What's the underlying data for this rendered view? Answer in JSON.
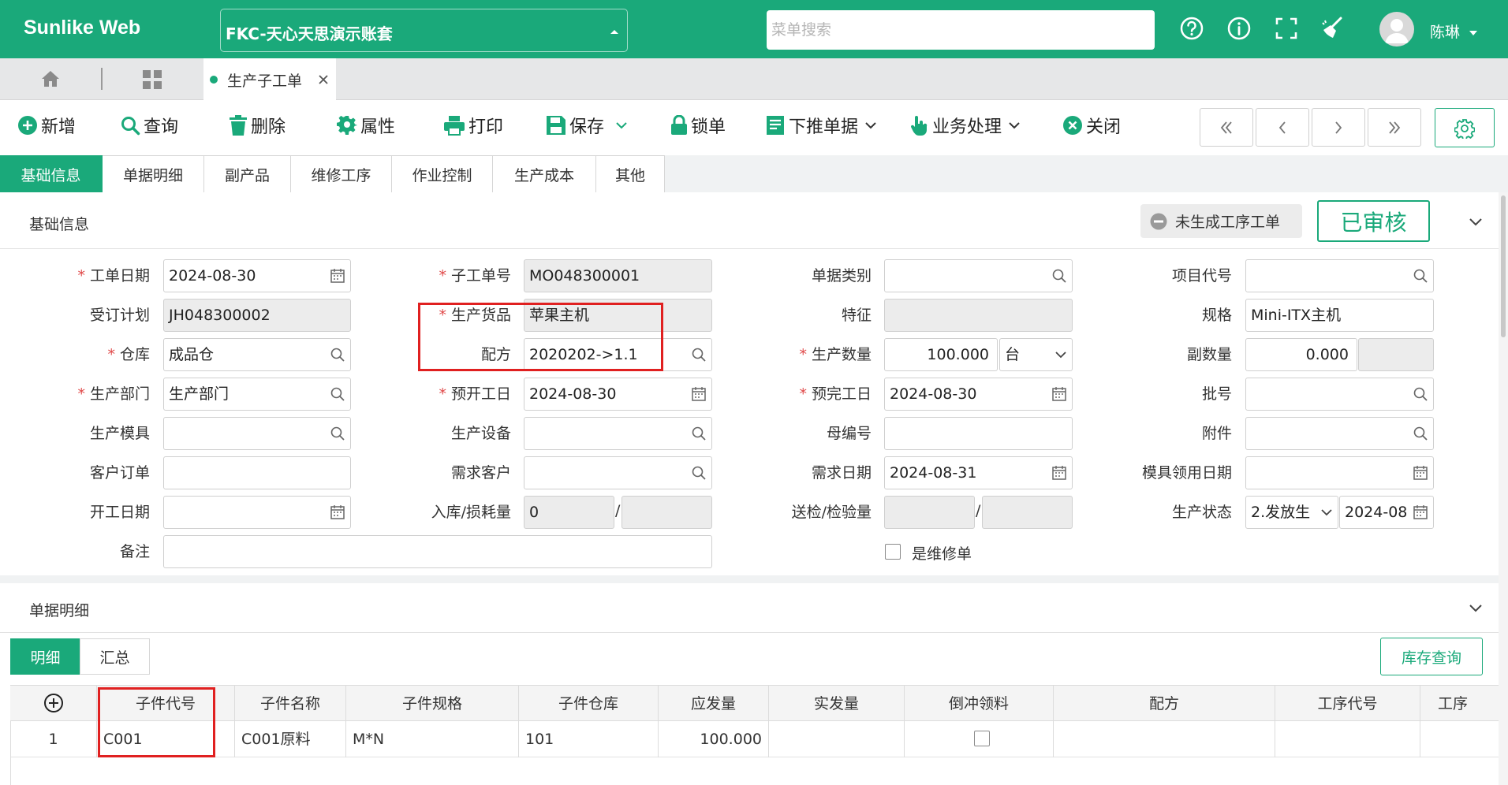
{
  "header": {
    "brand": "Sunlike Web",
    "account": "FKC-天心天思演示账套",
    "search_placeholder": "菜单搜索",
    "user": "陈琳",
    "icons": [
      "help-icon",
      "info-icon",
      "fullscreen-icon",
      "broom-icon"
    ]
  },
  "tabs": {
    "home_icon": "home-icon",
    "apps_icon": "grid-icon",
    "active_tab": "生产子工单"
  },
  "toolbar": {
    "add": "新增",
    "query": "查询",
    "delete": "删除",
    "properties": "属性",
    "print": "打印",
    "save": "保存",
    "lock": "锁单",
    "push_down": "下推单据",
    "business": "业务处理",
    "close": "关闭"
  },
  "section_tabs": [
    "基础信息",
    "单据明细",
    "副产品",
    "维修工序",
    "作业控制",
    "生产成本",
    "其他"
  ],
  "basic": {
    "title": "基础信息",
    "status_chip": "未生成工序工单",
    "approved": "已审核",
    "labels": {
      "order_date": "工单日期",
      "sub_order_no": "子工单号",
      "doc_type": "单据类别",
      "project_code": "项目代号",
      "order_plan": "受订计划",
      "product": "生产货品",
      "feature": "特征",
      "spec": "规格",
      "warehouse": "仓库",
      "formula": "配方",
      "quantity": "生产数量",
      "sub_quantity": "副数量",
      "department": "生产部门",
      "start_date": "预开工日",
      "finish_date": "预完工日",
      "batch": "批号",
      "mold": "生产模具",
      "equipment": "生产设备",
      "parent_no": "母编号",
      "attachment": "附件",
      "customer_order": "客户订单",
      "demand_customer": "需求客户",
      "demand_date": "需求日期",
      "mold_date": "模具领用日期",
      "open_date": "开工日期",
      "stock_loss": "入库/损耗量",
      "inspection": "送检/检验量",
      "prod_status": "生产状态",
      "remark": "备注",
      "is_repair": "是维修单"
    },
    "values": {
      "order_date": "2024-08-30",
      "sub_order_no": "MO048300001",
      "order_plan": "JH048300002",
      "product": "苹果主机",
      "spec": "Mini-ITX主机",
      "warehouse": "成品仓",
      "formula": "2020202->1.1",
      "quantity": "100.000",
      "unit": "台",
      "sub_quantity": "0.000",
      "department": "生产部门",
      "start_date": "2024-08-30",
      "finish_date": "2024-08-30",
      "demand_date": "2024-08-31",
      "stock_qty": "0",
      "prod_status": "2.发放生",
      "status_date": "2024-08"
    }
  },
  "detail": {
    "title": "单据明细",
    "tabs": [
      "明细",
      "汇总"
    ],
    "stock_query": "库存查询",
    "columns": [
      "子件代号",
      "子件名称",
      "子件规格",
      "子件仓库",
      "应发量",
      "实发量",
      "倒冲领料",
      "配方",
      "工序代号",
      "工序"
    ],
    "rows": [
      {
        "no": "1",
        "code": "C001",
        "name": "C001原料",
        "spec": "M*N",
        "warehouse": "101",
        "qty": "100.000"
      }
    ]
  },
  "colors": {
    "brand": "#1aa97a",
    "highlight": "#e02020"
  }
}
